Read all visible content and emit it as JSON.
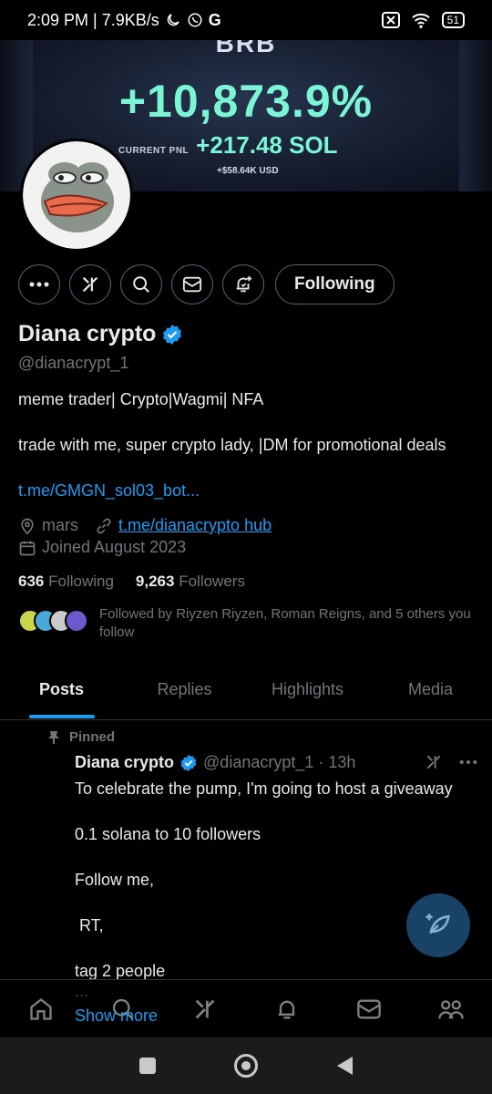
{
  "status_bar": {
    "time_speed": "2:09 PM | 7.9KB/s",
    "battery": "51"
  },
  "banner": {
    "ticker": "BRB",
    "pnl_percent": "+10,873.9%",
    "pnl_label": "CURRENT PNL",
    "pnl_sol": "+217.48 SOL",
    "pnl_usd": "+$58.64K USD"
  },
  "profile": {
    "follow_button": "Following",
    "name": "Diana crypto",
    "handle": "@dianacrypt_1",
    "bio_line1": "meme trader| Crypto|Wagmi| NFA",
    "bio_line2": "trade with me, super crypto lady, |DM for promotional deals",
    "bio_link": "t.me/GMGN_sol03_bot...",
    "location": "mars",
    "website": "t.me/dianacrypto hub",
    "joined": "Joined August 2023",
    "following_count": "636",
    "following_label": "Following",
    "followers_count": "9,263",
    "followers_label": "Followers",
    "followed_by": "Followed by Riyzen Riyzen, Roman Reigns, and 5 others you follow"
  },
  "tabs": [
    {
      "label": "Posts",
      "active": true
    },
    {
      "label": "Replies",
      "active": false
    },
    {
      "label": "Highlights",
      "active": false
    },
    {
      "label": "Media",
      "active": false
    }
  ],
  "pinned_tweet": {
    "pinned_label": "Pinned",
    "author": "Diana crypto",
    "handle_time": "@dianacrypt_1 · 13h",
    "lines": [
      "To celebrate the pump, I'm going to host a giveaway",
      "0.1 solana to 10 followers",
      "Follow me,",
      " RT,",
      "tag 2 people",
      "..."
    ],
    "show_more": "Show more"
  },
  "colors": {
    "accent": "#1d9bf0",
    "pnl_green": "#7cf5d5",
    "muted": "#71767b"
  },
  "icons": {
    "bottom_nav": [
      "home-icon",
      "search-icon",
      "grok-icon",
      "notifications-icon",
      "messages-icon",
      "communities-icon"
    ],
    "fab": "compose-icon"
  }
}
